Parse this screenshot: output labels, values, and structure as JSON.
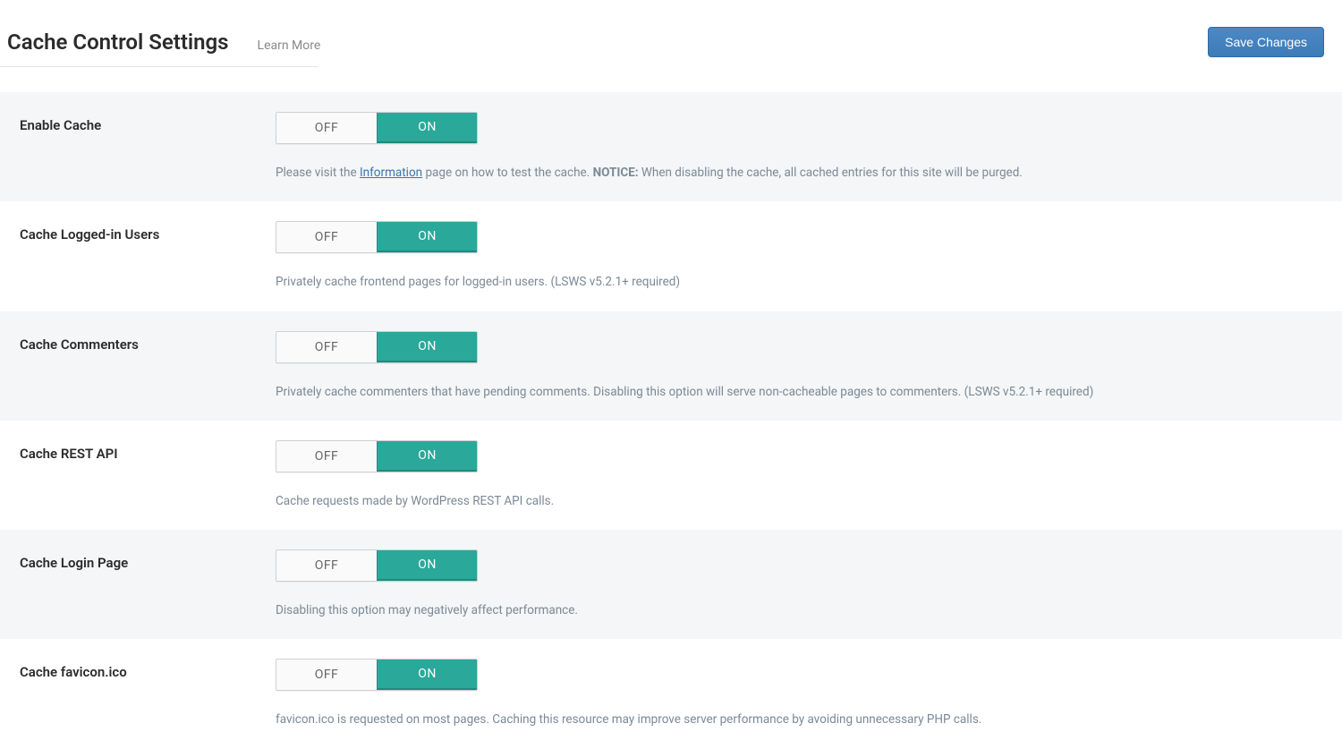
{
  "header": {
    "title": "Cache Control Settings",
    "learn_more": "Learn More",
    "save_button": "Save Changes"
  },
  "toggle": {
    "off": "OFF",
    "on": "ON"
  },
  "settings": {
    "enable_cache": {
      "label": "Enable Cache",
      "desc_prefix": "Please visit the ",
      "desc_link": "Information",
      "desc_mid": " page on how to test the cache. ",
      "desc_notice": "NOTICE:",
      "desc_suffix": " When disabling the cache, all cached entries for this site will be purged."
    },
    "cache_logged_in": {
      "label": "Cache Logged-in Users",
      "desc": "Privately cache frontend pages for logged-in users. (LSWS v5.2.1+ required)"
    },
    "cache_commenters": {
      "label": "Cache Commenters",
      "desc": "Privately cache commenters that have pending comments. Disabling this option will serve non-cacheable pages to commenters. (LSWS v5.2.1+ required)"
    },
    "cache_rest_api": {
      "label": "Cache REST API",
      "desc": "Cache requests made by WordPress REST API calls."
    },
    "cache_login_page": {
      "label": "Cache Login Page",
      "desc": "Disabling this option may negatively affect performance."
    },
    "cache_favicon": {
      "label": "Cache favicon.ico",
      "desc": "favicon.ico is requested on most pages. Caching this resource may improve server performance by avoiding unnecessary PHP calls."
    }
  }
}
